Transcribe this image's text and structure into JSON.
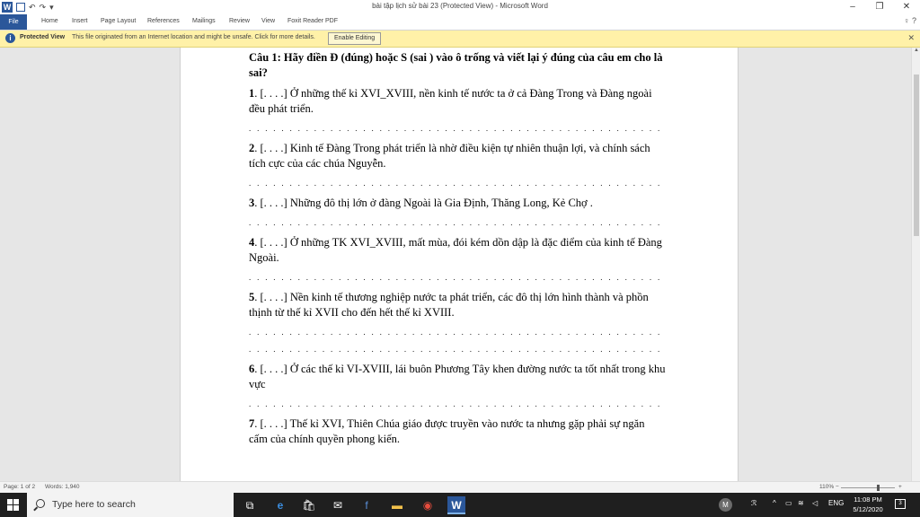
{
  "window": {
    "title": "bài tập lịch sử bài 23 (Protected View) - Microsoft Word",
    "minimize": "–",
    "restore": "❐",
    "close": "✕"
  },
  "qat": {
    "word_logo": "W",
    "undo": "↶",
    "redo": "↷",
    "more": "▾"
  },
  "ribbon": {
    "tabs": [
      "File",
      "Home",
      "Insert",
      "Page Layout",
      "References",
      "Mailings",
      "Review",
      "View",
      "Foxit Reader PDF"
    ],
    "right_icons": "♀ ?"
  },
  "protected_view": {
    "title": "Protected View",
    "message": "This file originated from an Internet location and might be unsafe. Click for more details.",
    "button": "Enable Editing",
    "close": "✕"
  },
  "document": {
    "question_heading": "Câu 1: Hãy điền Đ (đúng) hoặc S (sai ) vào ô trống và viết lại ý đúng của câu em cho là sai?",
    "dots": ". . . . . . . . . . . . . . . . . . . . . . . . . . . . . . . . . . . . . . . . . . . . . . . . . . . . . . . . . . . . . . . . . . . . . . . . . . . . . . .",
    "items": [
      {
        "num": "1",
        "text": ". [. . . .]  Ở những thế kỉ XVI_XVIII, nền kinh tế nước ta ở cả Đàng Trong và Đàng ngoài đều phát triển."
      },
      {
        "num": "2",
        "text": ". [. . . .] Kinh tế Đàng Trong phát triển là nhờ điều kiện tự nhiên thuận lợi, và chính sách tích cực của các chúa Nguyễn."
      },
      {
        "num": "3",
        "text": ". [. . . .] Những đô thị lớn ở đàng Ngoài là Gia Định, Thăng Long, Kẻ Chợ ."
      },
      {
        "num": "4",
        "text": ". [. . . .] Ở những TK XVI_XVIII, mất mùa, đói kém dồn dập là đặc điểm của kinh tế Đàng Ngoài."
      },
      {
        "num": "5",
        "text": ". [. . . .]  Nền kinh tế thương nghiệp nước ta phát triển, các đô thị lớn hình thành và phồn thịnh từ thế kỉ XVII cho đến hết thế kỉ XVIII."
      },
      {
        "num": "6",
        "text": ". [. . . .]  Ở các thế kỉ VI-XVIII, lái buôn Phương Tây khen đường nước ta tốt nhất trong khu vực"
      },
      {
        "num": "7",
        "text": ". [. . . .]  Thế kỉ XVI, Thiên Chúa giáo được truyền vào nước ta nhưng gặp phải sự ngăn cấm của chính quyền phong kiến."
      }
    ]
  },
  "statusbar": {
    "page": "Page: 1 of 2",
    "words": "Words: 1,940",
    "zoom": "110%",
    "minus": "−",
    "plus": "+"
  },
  "taskbar": {
    "search_placeholder": "Type here to search",
    "avatar": "M",
    "lang": "ENG",
    "time": "11:08 PM",
    "date": "5/12/2020",
    "notifications": "3"
  }
}
